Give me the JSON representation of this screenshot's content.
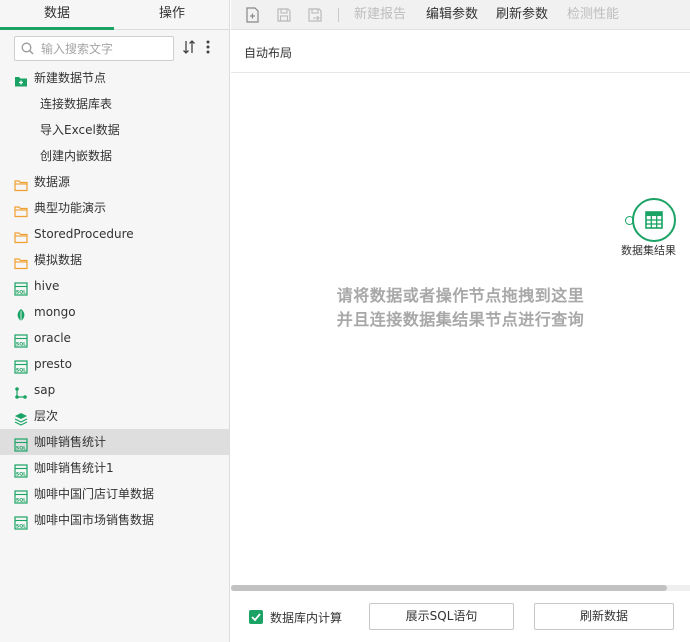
{
  "left_panel": {
    "tabs": [
      {
        "label": "数据",
        "active": true
      },
      {
        "label": "操作",
        "active": false
      }
    ],
    "search": {
      "placeholder": "输入搜索文字",
      "value": ""
    },
    "tree": [
      {
        "label": "新建数据节点",
        "icon": "add-folder-icon",
        "level": 0
      },
      {
        "label": "连接数据库表",
        "icon": "",
        "level": 1
      },
      {
        "label": "导入Excel数据",
        "icon": "",
        "level": 1
      },
      {
        "label": "创建内嵌数据",
        "icon": "",
        "level": 1
      },
      {
        "label": "数据源",
        "icon": "folder-icon",
        "level": 0
      },
      {
        "label": "典型功能演示",
        "icon": "folder-icon",
        "level": 0
      },
      {
        "label": "StoredProcedure",
        "icon": "folder-icon",
        "level": 0
      },
      {
        "label": "模拟数据",
        "icon": "folder-icon",
        "level": 0
      },
      {
        "label": "hive",
        "icon": "sql-icon",
        "level": 0
      },
      {
        "label": "mongo",
        "icon": "leaf-icon",
        "level": 0
      },
      {
        "label": "oracle",
        "icon": "sql-icon",
        "level": 0
      },
      {
        "label": "presto",
        "icon": "sql-icon",
        "level": 0
      },
      {
        "label": "sap",
        "icon": "hierarchy-icon",
        "level": 0
      },
      {
        "label": "层次",
        "icon": "layers-icon",
        "level": 0
      },
      {
        "label": "咖啡销售统计",
        "icon": "sql-icon",
        "level": 0,
        "selected": true
      },
      {
        "label": "咖啡销售统计1",
        "icon": "sql-icon",
        "level": 0
      },
      {
        "label": "咖啡中国门店订单数据",
        "icon": "sql-icon",
        "level": 0
      },
      {
        "label": "咖啡中国市场销售数据",
        "icon": "sql-icon",
        "level": 0
      }
    ]
  },
  "toolbar": {
    "new_report": "新建报告",
    "edit_params": "编辑参数",
    "refresh_params": "刷新参数",
    "check_performance": "检测性能"
  },
  "layout_bar": {
    "label": "自动布局"
  },
  "canvas": {
    "hint_line1": "请将数据或者操作节点拖拽到这里",
    "hint_line2": "并且连接数据集结果节点进行查询",
    "result_node_label": "数据集结果"
  },
  "footer": {
    "db_compute_label": "数据库内计算",
    "db_compute_checked": true,
    "show_sql_button": "展示SQL语句",
    "refresh_data_button": "刷新数据"
  },
  "colors": {
    "accent": "#1aa364",
    "folder": "#f0a030"
  }
}
